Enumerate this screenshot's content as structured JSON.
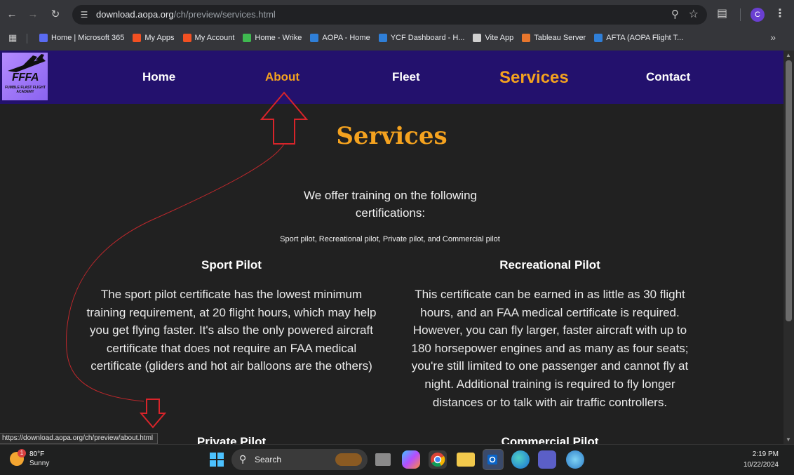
{
  "browser": {
    "url_domain": "download.aopa.org",
    "url_path": "/ch/preview/services.html",
    "profile_initial": "C",
    "bookmarks": [
      {
        "label": "Home | Microsoft 365",
        "color": "#5a6bf2"
      },
      {
        "label": "My Apps",
        "color": "#f25022"
      },
      {
        "label": "My Account",
        "color": "#f25022"
      },
      {
        "label": "Home - Wrike",
        "color": "#3fb950"
      },
      {
        "label": "AOPA - Home",
        "color": "#2f7fd8"
      },
      {
        "label": "YCF Dashboard - H...",
        "color": "#2f7fd8"
      },
      {
        "label": "Vite App",
        "color": "#d0d0d0"
      },
      {
        "label": "Tableau Server",
        "color": "#e8762d"
      },
      {
        "label": "AFTA (AOPA Flight T...",
        "color": "#2f7fd8"
      }
    ]
  },
  "site": {
    "logo_text": "FFFA",
    "logo_subtext": "FUMBLE FLAST FLIGHT ACADEMY",
    "nav": {
      "home": "Home",
      "about": "About",
      "fleet": "Fleet",
      "services": "Services",
      "contact": "Contact"
    },
    "title": "Services",
    "intro": "We offer training on the following certifications:",
    "cert_list": "Sport pilot, Recreational pilot, Private pilot, and Commercial pilot",
    "sections": {
      "sport": {
        "heading": "Sport Pilot",
        "body": "The sport pilot certificate has the lowest minimum training requirement, at 20 flight hours, which may help you get flying faster. It's also the only powered aircraft certificate that does not require an FAA medical certificate (gliders and hot air balloons are the others)"
      },
      "recreational": {
        "heading": "Recreational Pilot",
        "body": "This certificate can be earned in as little as 30 flight hours, and an FAA medical certificate is required. However, you can fly larger, faster aircraft with up to 180 horsepower engines and as many as four seats; you're still limited to one passenger and cannot fly at night. Additional training is required to fly longer distances or to talk with air traffic controllers."
      },
      "private": {
        "heading": "Private Pilot"
      },
      "commercial": {
        "heading": "Commercial Pilot"
      }
    },
    "status_url": "https://download.aopa.org/ch/preview/about.html"
  },
  "taskbar": {
    "weather_temp": "80°F",
    "weather_cond": "Sunny",
    "weather_badge": "1",
    "search_label": "Search",
    "time": "2:19 PM",
    "date": "10/22/2024"
  },
  "colors": {
    "nav_bg": "#23116d",
    "accent": "#f4a21f",
    "page_bg": "#212121",
    "annotation": "#d8242a"
  }
}
